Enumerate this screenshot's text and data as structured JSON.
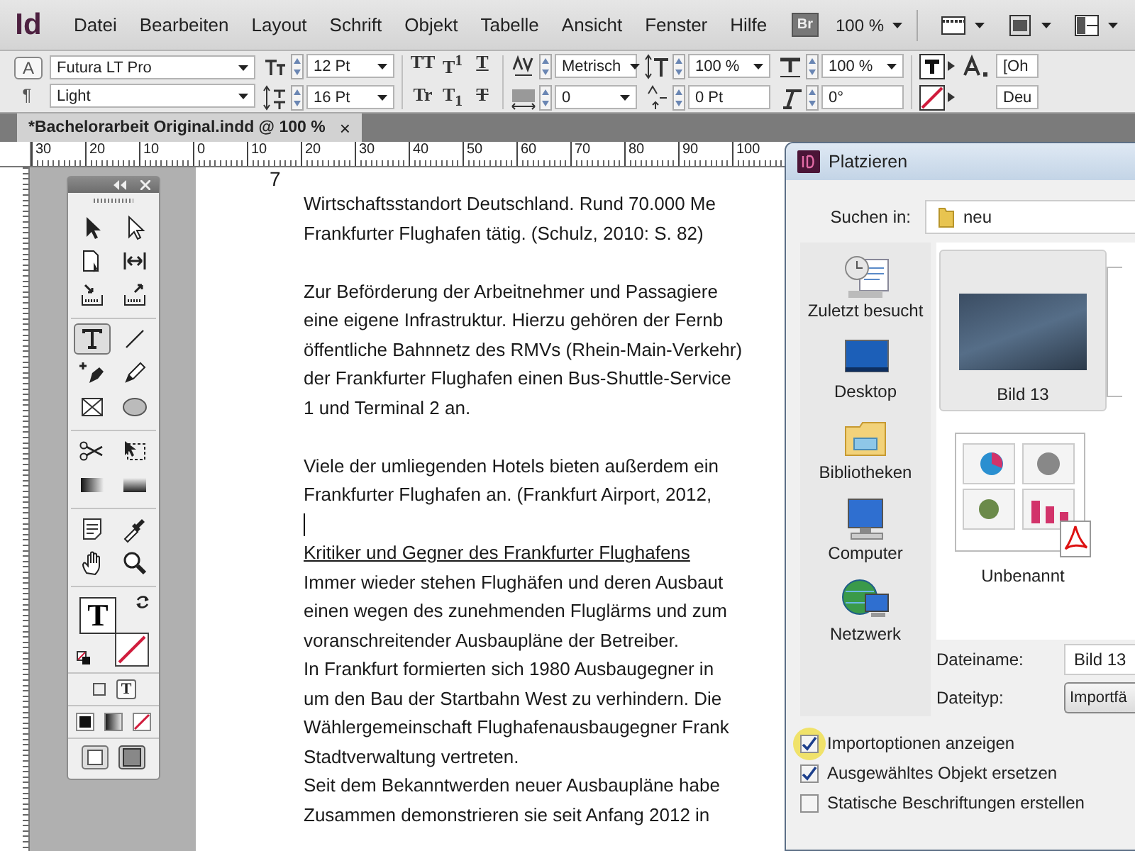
{
  "app": {
    "logo": "Id"
  },
  "menu": [
    "Datei",
    "Bearbeiten",
    "Layout",
    "Schrift",
    "Objekt",
    "Tabelle",
    "Ansicht",
    "Fenster",
    "Hilfe"
  ],
  "toolbar": {
    "bridge": "Br",
    "zoom": "100 %"
  },
  "control_panel": {
    "modes": [
      {
        "glyph": "A",
        "selected": true
      },
      {
        "glyph": "¶",
        "selected": false
      }
    ],
    "font_family": "Futura LT Pro",
    "font_style": "Light",
    "size_fields": [
      {
        "kind": "dropdown",
        "value": "12 Pt"
      },
      {
        "kind": "dropdown",
        "value": "16 Pt"
      }
    ],
    "type_styles": [
      {
        "glyph": "TT",
        "kind": "plain"
      },
      {
        "glyph": "T$^{1}$",
        "kind": "plain"
      },
      {
        "glyph": "T",
        "kind": "underline"
      },
      {
        "glyph": "Tr",
        "kind": "plain"
      },
      {
        "glyph": "T$_{1}$",
        "kind": "plain"
      },
      {
        "glyph": "T",
        "kind": "strike"
      }
    ],
    "spacing_fields": [
      {
        "kind": "dropdown",
        "value": "Metrisch"
      },
      {
        "kind": "dropdown",
        "value": "0"
      }
    ],
    "scale_fields": [
      {
        "kind": "dropdown",
        "value": "100 %"
      },
      {
        "kind": "input",
        "value": "0 Pt"
      }
    ],
    "shape_fields": [
      {
        "kind": "dropdown",
        "value": "100 %"
      },
      {
        "kind": "input",
        "value": "0°"
      }
    ],
    "style_fields": [
      "[Oh",
      "Deu"
    ]
  },
  "document_tab": {
    "title": "*Bachelorarbeit Original.indd @ 100 %",
    "close": "×"
  },
  "ruler": [
    "30",
    "20",
    "10",
    "0",
    "10",
    "20",
    "30",
    "40",
    "50",
    "60",
    "70",
    "80",
    "90",
    "100"
  ],
  "tools_panel": {
    "groups": [
      [
        {
          "kind": "selection",
          "selected": false
        },
        {
          "kind": "direct_selection",
          "selected": false
        },
        {
          "kind": "page",
          "selected": false
        },
        {
          "kind": "gap",
          "selected": false
        },
        {
          "kind": "content_collector",
          "selected": false
        },
        {
          "kind": "content_placer",
          "selected": false
        }
      ],
      [
        {
          "kind": "type",
          "selected": true
        },
        {
          "kind": "line",
          "selected": false
        },
        {
          "kind": "pen",
          "selected": false
        },
        {
          "kind": "pencil",
          "selected": false
        },
        {
          "kind": "rectangle_frame",
          "selected": false
        },
        {
          "kind": "ellipse",
          "selected": false
        }
      ],
      [
        {
          "kind": "scissors",
          "selected": false
        },
        {
          "kind": "free_transform",
          "selected": false
        },
        {
          "kind": "gradient_swatch",
          "selected": false
        },
        {
          "kind": "gradient_feather",
          "selected": false
        }
      ],
      [
        {
          "kind": "note",
          "selected": false
        },
        {
          "kind": "eyedropper",
          "selected": false
        },
        {
          "kind": "hand",
          "selected": false
        },
        {
          "kind": "zoom",
          "selected": false
        }
      ]
    ],
    "fill_glyph": "T",
    "format_glyph": "T"
  },
  "document": {
    "page_number": "7",
    "lines": [
      {
        "kind": "body",
        "text": "Wirtschaftsstandort Deutschland. Rund 70.000 Me"
      },
      {
        "kind": "body",
        "text": "Frankfurter Flughafen tätig. (Schulz, 2010: S. 82)"
      },
      {
        "kind": "blank"
      },
      {
        "kind": "body",
        "text": "Zur Beförderung der Arbeitnehmer und Passagiere"
      },
      {
        "kind": "body",
        "text": "eine eigene Infrastruktur. Hierzu gehören der Fernb"
      },
      {
        "kind": "body",
        "text": "öffentliche Bahnnetz des RMVs (Rhein-Main-Verkehr)"
      },
      {
        "kind": "body",
        "text": "der Frankfurter Flughafen einen Bus-Shuttle-Service"
      },
      {
        "kind": "body",
        "text": "1 und Terminal 2 an."
      },
      {
        "kind": "blank"
      },
      {
        "kind": "body",
        "text": "Viele der umliegenden Hotels bieten außerdem ein"
      },
      {
        "kind": "body",
        "text": "Frankfurter Flughafen an. (Frankfurt Airport, 2012,"
      },
      {
        "kind": "cursor"
      },
      {
        "kind": "heading",
        "text": "Kritiker und Gegner des Frankfurter Flughafens"
      },
      {
        "kind": "body",
        "text": "Immer wieder stehen Flughäfen und deren Ausbaut"
      },
      {
        "kind": "body",
        "text": "einen wegen des zunehmenden Fluglärms und zum"
      },
      {
        "kind": "body",
        "text": "voranschreitender Ausbaupläne der Betreiber."
      },
      {
        "kind": "body",
        "text": "In Frankfurt formierten sich 1980 Ausbaugegner in"
      },
      {
        "kind": "body",
        "text": "um den Bau der Startbahn West zu verhindern. Die"
      },
      {
        "kind": "body",
        "text": "Wählergemeinschaft Flughafenausbaugegner Frank"
      },
      {
        "kind": "body",
        "text": "Stadtverwaltung vertreten."
      },
      {
        "kind": "body",
        "text": "Seit dem Bekanntwerden neuer Ausbaupläne habe"
      },
      {
        "kind": "body",
        "text": "Zusammen demonstrieren sie seit Anfang 2012 in"
      }
    ]
  },
  "dialog": {
    "title": "Platzieren",
    "look_in_label": "Suchen in:",
    "look_in_value": "neu",
    "places": [
      {
        "kind": "recent",
        "label": "Zuletzt besucht"
      },
      {
        "kind": "desktop",
        "label": "Desktop"
      },
      {
        "kind": "libraries",
        "label": "Bibliotheken"
      },
      {
        "kind": "computer",
        "label": "Computer"
      },
      {
        "kind": "network",
        "label": "Netzwerk"
      }
    ],
    "files": [
      {
        "kind": "image",
        "name": "Bild 13",
        "selected": true
      },
      {
        "kind": "pdf",
        "name": "Unbenannt",
        "selected": false
      }
    ],
    "filename_label": "Dateiname:",
    "filename_value": "Bild 13",
    "filetype_label": "Dateityp:",
    "filetype_value": "Importfä",
    "options": [
      {
        "label": "Importoptionen anzeigen",
        "checked": true,
        "highlighted": true
      },
      {
        "label": "Ausgewähltes Objekt ersetzen",
        "checked": true,
        "highlighted": false
      },
      {
        "label": "Statische Beschriftungen erstellen",
        "checked": false,
        "highlighted": false
      }
    ]
  }
}
